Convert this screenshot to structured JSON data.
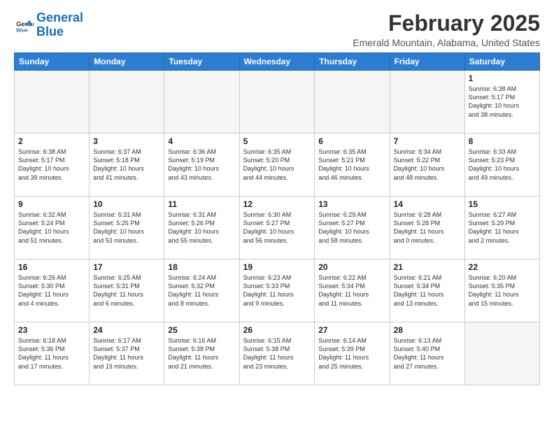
{
  "header": {
    "logo_line1": "General",
    "logo_line2": "Blue",
    "title": "February 2025",
    "subtitle": "Emerald Mountain, Alabama, United States"
  },
  "weekdays": [
    "Sunday",
    "Monday",
    "Tuesday",
    "Wednesday",
    "Thursday",
    "Friday",
    "Saturday"
  ],
  "weeks": [
    [
      {
        "day": "",
        "info": ""
      },
      {
        "day": "",
        "info": ""
      },
      {
        "day": "",
        "info": ""
      },
      {
        "day": "",
        "info": ""
      },
      {
        "day": "",
        "info": ""
      },
      {
        "day": "",
        "info": ""
      },
      {
        "day": "1",
        "info": "Sunrise: 6:38 AM\nSunset: 5:17 PM\nDaylight: 10 hours\nand 38 minutes."
      }
    ],
    [
      {
        "day": "2",
        "info": "Sunrise: 6:38 AM\nSunset: 5:17 PM\nDaylight: 10 hours\nand 39 minutes."
      },
      {
        "day": "3",
        "info": "Sunrise: 6:37 AM\nSunset: 5:18 PM\nDaylight: 10 hours\nand 41 minutes."
      },
      {
        "day": "4",
        "info": "Sunrise: 6:36 AM\nSunset: 5:19 PM\nDaylight: 10 hours\nand 43 minutes."
      },
      {
        "day": "5",
        "info": "Sunrise: 6:35 AM\nSunset: 5:20 PM\nDaylight: 10 hours\nand 44 minutes."
      },
      {
        "day": "6",
        "info": "Sunrise: 6:35 AM\nSunset: 5:21 PM\nDaylight: 10 hours\nand 46 minutes."
      },
      {
        "day": "7",
        "info": "Sunrise: 6:34 AM\nSunset: 5:22 PM\nDaylight: 10 hours\nand 48 minutes."
      },
      {
        "day": "8",
        "info": "Sunrise: 6:33 AM\nSunset: 5:23 PM\nDaylight: 10 hours\nand 49 minutes."
      }
    ],
    [
      {
        "day": "9",
        "info": "Sunrise: 6:32 AM\nSunset: 5:24 PM\nDaylight: 10 hours\nand 51 minutes."
      },
      {
        "day": "10",
        "info": "Sunrise: 6:31 AM\nSunset: 5:25 PM\nDaylight: 10 hours\nand 53 minutes."
      },
      {
        "day": "11",
        "info": "Sunrise: 6:31 AM\nSunset: 5:26 PM\nDaylight: 10 hours\nand 55 minutes."
      },
      {
        "day": "12",
        "info": "Sunrise: 6:30 AM\nSunset: 5:27 PM\nDaylight: 10 hours\nand 56 minutes."
      },
      {
        "day": "13",
        "info": "Sunrise: 6:29 AM\nSunset: 5:27 PM\nDaylight: 10 hours\nand 58 minutes."
      },
      {
        "day": "14",
        "info": "Sunrise: 6:28 AM\nSunset: 5:28 PM\nDaylight: 11 hours\nand 0 minutes."
      },
      {
        "day": "15",
        "info": "Sunrise: 6:27 AM\nSunset: 5:29 PM\nDaylight: 11 hours\nand 2 minutes."
      }
    ],
    [
      {
        "day": "16",
        "info": "Sunrise: 6:26 AM\nSunset: 5:30 PM\nDaylight: 11 hours\nand 4 minutes."
      },
      {
        "day": "17",
        "info": "Sunrise: 6:25 AM\nSunset: 5:31 PM\nDaylight: 11 hours\nand 6 minutes."
      },
      {
        "day": "18",
        "info": "Sunrise: 6:24 AM\nSunset: 5:32 PM\nDaylight: 11 hours\nand 8 minutes."
      },
      {
        "day": "19",
        "info": "Sunrise: 6:23 AM\nSunset: 5:33 PM\nDaylight: 11 hours\nand 9 minutes."
      },
      {
        "day": "20",
        "info": "Sunrise: 6:22 AM\nSunset: 5:34 PM\nDaylight: 11 hours\nand 11 minutes."
      },
      {
        "day": "21",
        "info": "Sunrise: 6:21 AM\nSunset: 5:34 PM\nDaylight: 11 hours\nand 13 minutes."
      },
      {
        "day": "22",
        "info": "Sunrise: 6:20 AM\nSunset: 5:35 PM\nDaylight: 11 hours\nand 15 minutes."
      }
    ],
    [
      {
        "day": "23",
        "info": "Sunrise: 6:18 AM\nSunset: 5:36 PM\nDaylight: 11 hours\nand 17 minutes."
      },
      {
        "day": "24",
        "info": "Sunrise: 6:17 AM\nSunset: 5:37 PM\nDaylight: 11 hours\nand 19 minutes."
      },
      {
        "day": "25",
        "info": "Sunrise: 6:16 AM\nSunset: 5:38 PM\nDaylight: 11 hours\nand 21 minutes."
      },
      {
        "day": "26",
        "info": "Sunrise: 6:15 AM\nSunset: 5:38 PM\nDaylight: 11 hours\nand 23 minutes."
      },
      {
        "day": "27",
        "info": "Sunrise: 6:14 AM\nSunset: 5:39 PM\nDaylight: 11 hours\nand 25 minutes."
      },
      {
        "day": "28",
        "info": "Sunrise: 6:13 AM\nSunset: 5:40 PM\nDaylight: 11 hours\nand 27 minutes."
      },
      {
        "day": "",
        "info": ""
      }
    ]
  ]
}
